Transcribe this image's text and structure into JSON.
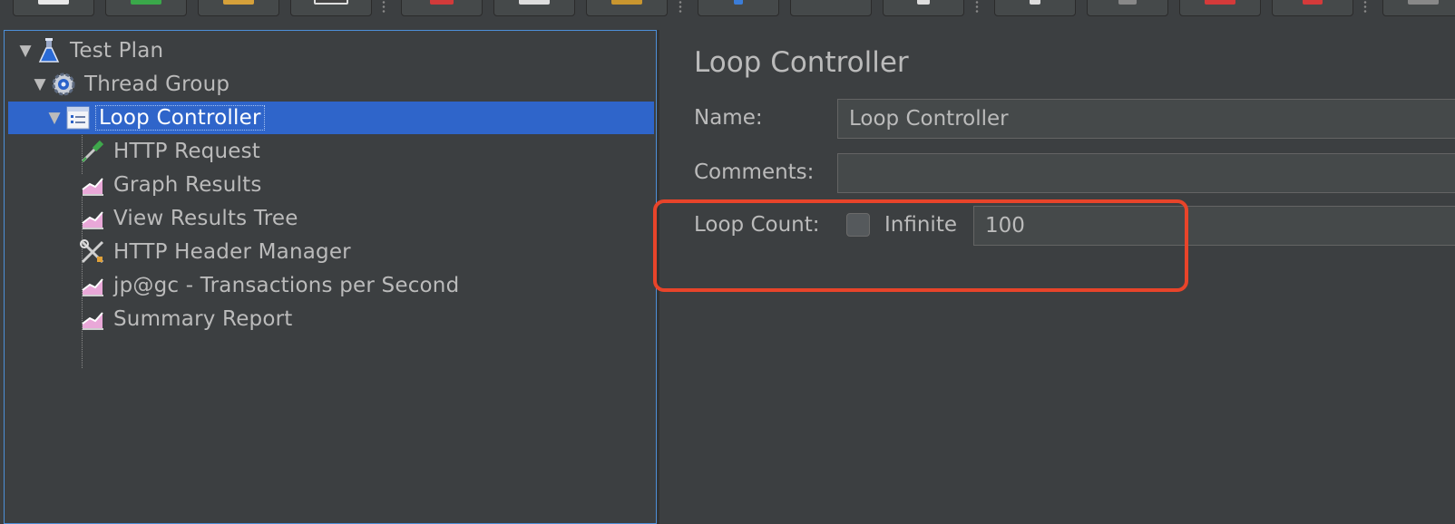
{
  "toolbar": {
    "buttons": [
      {
        "icon": "new-icon",
        "color": "#e8e8e8"
      },
      {
        "icon": "templates-icon",
        "color": "#3aa84a"
      },
      {
        "icon": "open-icon",
        "color": "#d6a13a"
      },
      {
        "icon": "save-icon",
        "color": "#444444"
      },
      {
        "icon": "cut-icon",
        "color": "#d23a3a"
      },
      {
        "icon": "copy-icon",
        "color": "#dddddd"
      },
      {
        "icon": "paste-icon",
        "color": "#c9962f"
      },
      {
        "icon": "expand-icon",
        "color": "#3b7dd8"
      },
      {
        "icon": "collapse-icon",
        "color": "#45494a"
      },
      {
        "icon": "toggle-icon",
        "color": "#dddddd"
      },
      {
        "icon": "start-icon",
        "color": "#dddddd"
      },
      {
        "icon": "start-no-pause-icon",
        "color": "#888888"
      },
      {
        "icon": "stop-icon",
        "color": "#d43a3a"
      },
      {
        "icon": "shutdown-icon",
        "color": "#d43a3a"
      },
      {
        "icon": "more-icon",
        "color": "#888888"
      }
    ]
  },
  "tree": {
    "items": [
      {
        "label": "Test Plan",
        "icon": "test-plan-flask-icon"
      },
      {
        "label": "Thread Group",
        "icon": "thread-group-gear-icon"
      },
      {
        "label": "Loop Controller",
        "icon": "loop-controller-icon",
        "selected": true
      },
      {
        "label": "HTTP Request",
        "icon": "http-request-pipette-icon"
      },
      {
        "label": "Graph Results",
        "icon": "graph-results-icon"
      },
      {
        "label": "View Results Tree",
        "icon": "view-results-tree-icon"
      },
      {
        "label": "HTTP Header Manager",
        "icon": "header-manager-tools-icon"
      },
      {
        "label": "jp@gc - Transactions per Second",
        "icon": "transactions-graph-icon"
      },
      {
        "label": "Summary Report",
        "icon": "summary-report-icon"
      }
    ]
  },
  "panel": {
    "title": "Loop Controller",
    "name_label": "Name:",
    "name_value": "Loop Controller",
    "comments_label": "Comments:",
    "comments_value": "",
    "loop_count_label": "Loop Count:",
    "infinite_label": "Infinite",
    "infinite_checked": false,
    "loop_count_value": "100"
  },
  "colors": {
    "background": "#3c3f41",
    "selection": "#2f65ca",
    "highlight_border": "#e8442a"
  }
}
